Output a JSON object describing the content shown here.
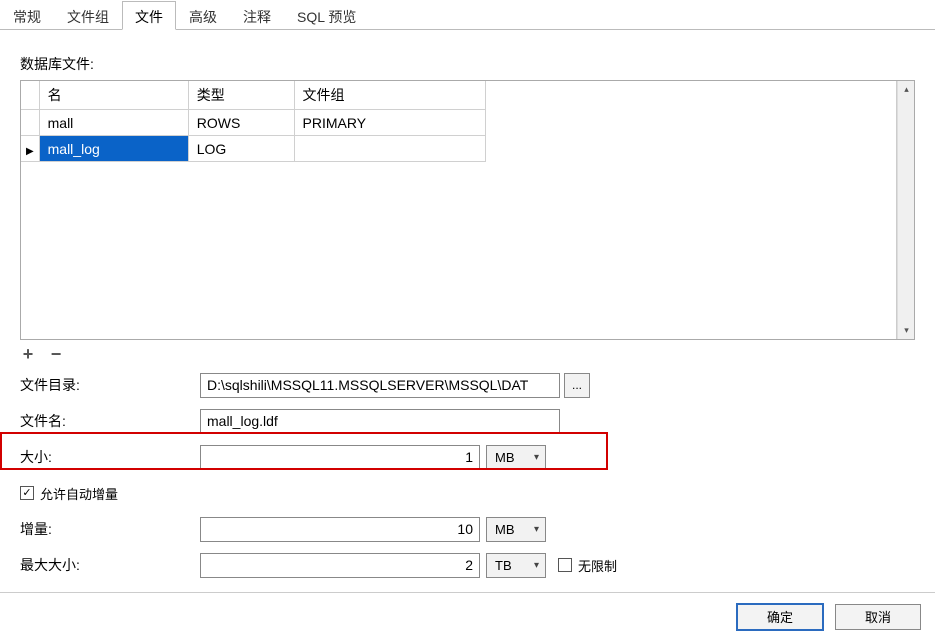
{
  "tabs": {
    "general": "常规",
    "filegroup": "文件组",
    "files": "文件",
    "advanced": "高级",
    "comment": "注释",
    "sqlpreview": "SQL 预览"
  },
  "labels": {
    "db_files": "数据库文件:",
    "file_dir": "文件目录:",
    "file_name": "文件名:",
    "size": "大小:",
    "allow_autogrow": "允许自动增量",
    "growth": "增量:",
    "max_size": "最大大小:",
    "unlimited": "无限制"
  },
  "grid": {
    "headers": {
      "name": "名",
      "type": "类型",
      "group": "文件组"
    },
    "rows": [
      {
        "name": "mall",
        "type": "ROWS",
        "group": "PRIMARY",
        "selected": false
      },
      {
        "name": "mall_log",
        "type": "LOG",
        "group": "",
        "selected": true
      }
    ]
  },
  "form": {
    "file_dir": "D:\\sqlshili\\MSSQL11.MSSQLSERVER\\MSSQL\\DAT",
    "file_name": "mall_log.ldf",
    "size_value": "1",
    "size_unit": "MB",
    "autogrow_checked": true,
    "growth_value": "10",
    "growth_unit": "MB",
    "maxsize_value": "2",
    "maxsize_unit": "TB",
    "unlimited_checked": false
  },
  "icons": {
    "browse": "...",
    "plus": "+",
    "minus": "−",
    "chevron_down": "▾",
    "scroll_up": "▴",
    "scroll_down": "▾",
    "row_arrow": "▶",
    "check": "✓"
  },
  "buttons": {
    "ok": "确定",
    "cancel": "取消"
  }
}
